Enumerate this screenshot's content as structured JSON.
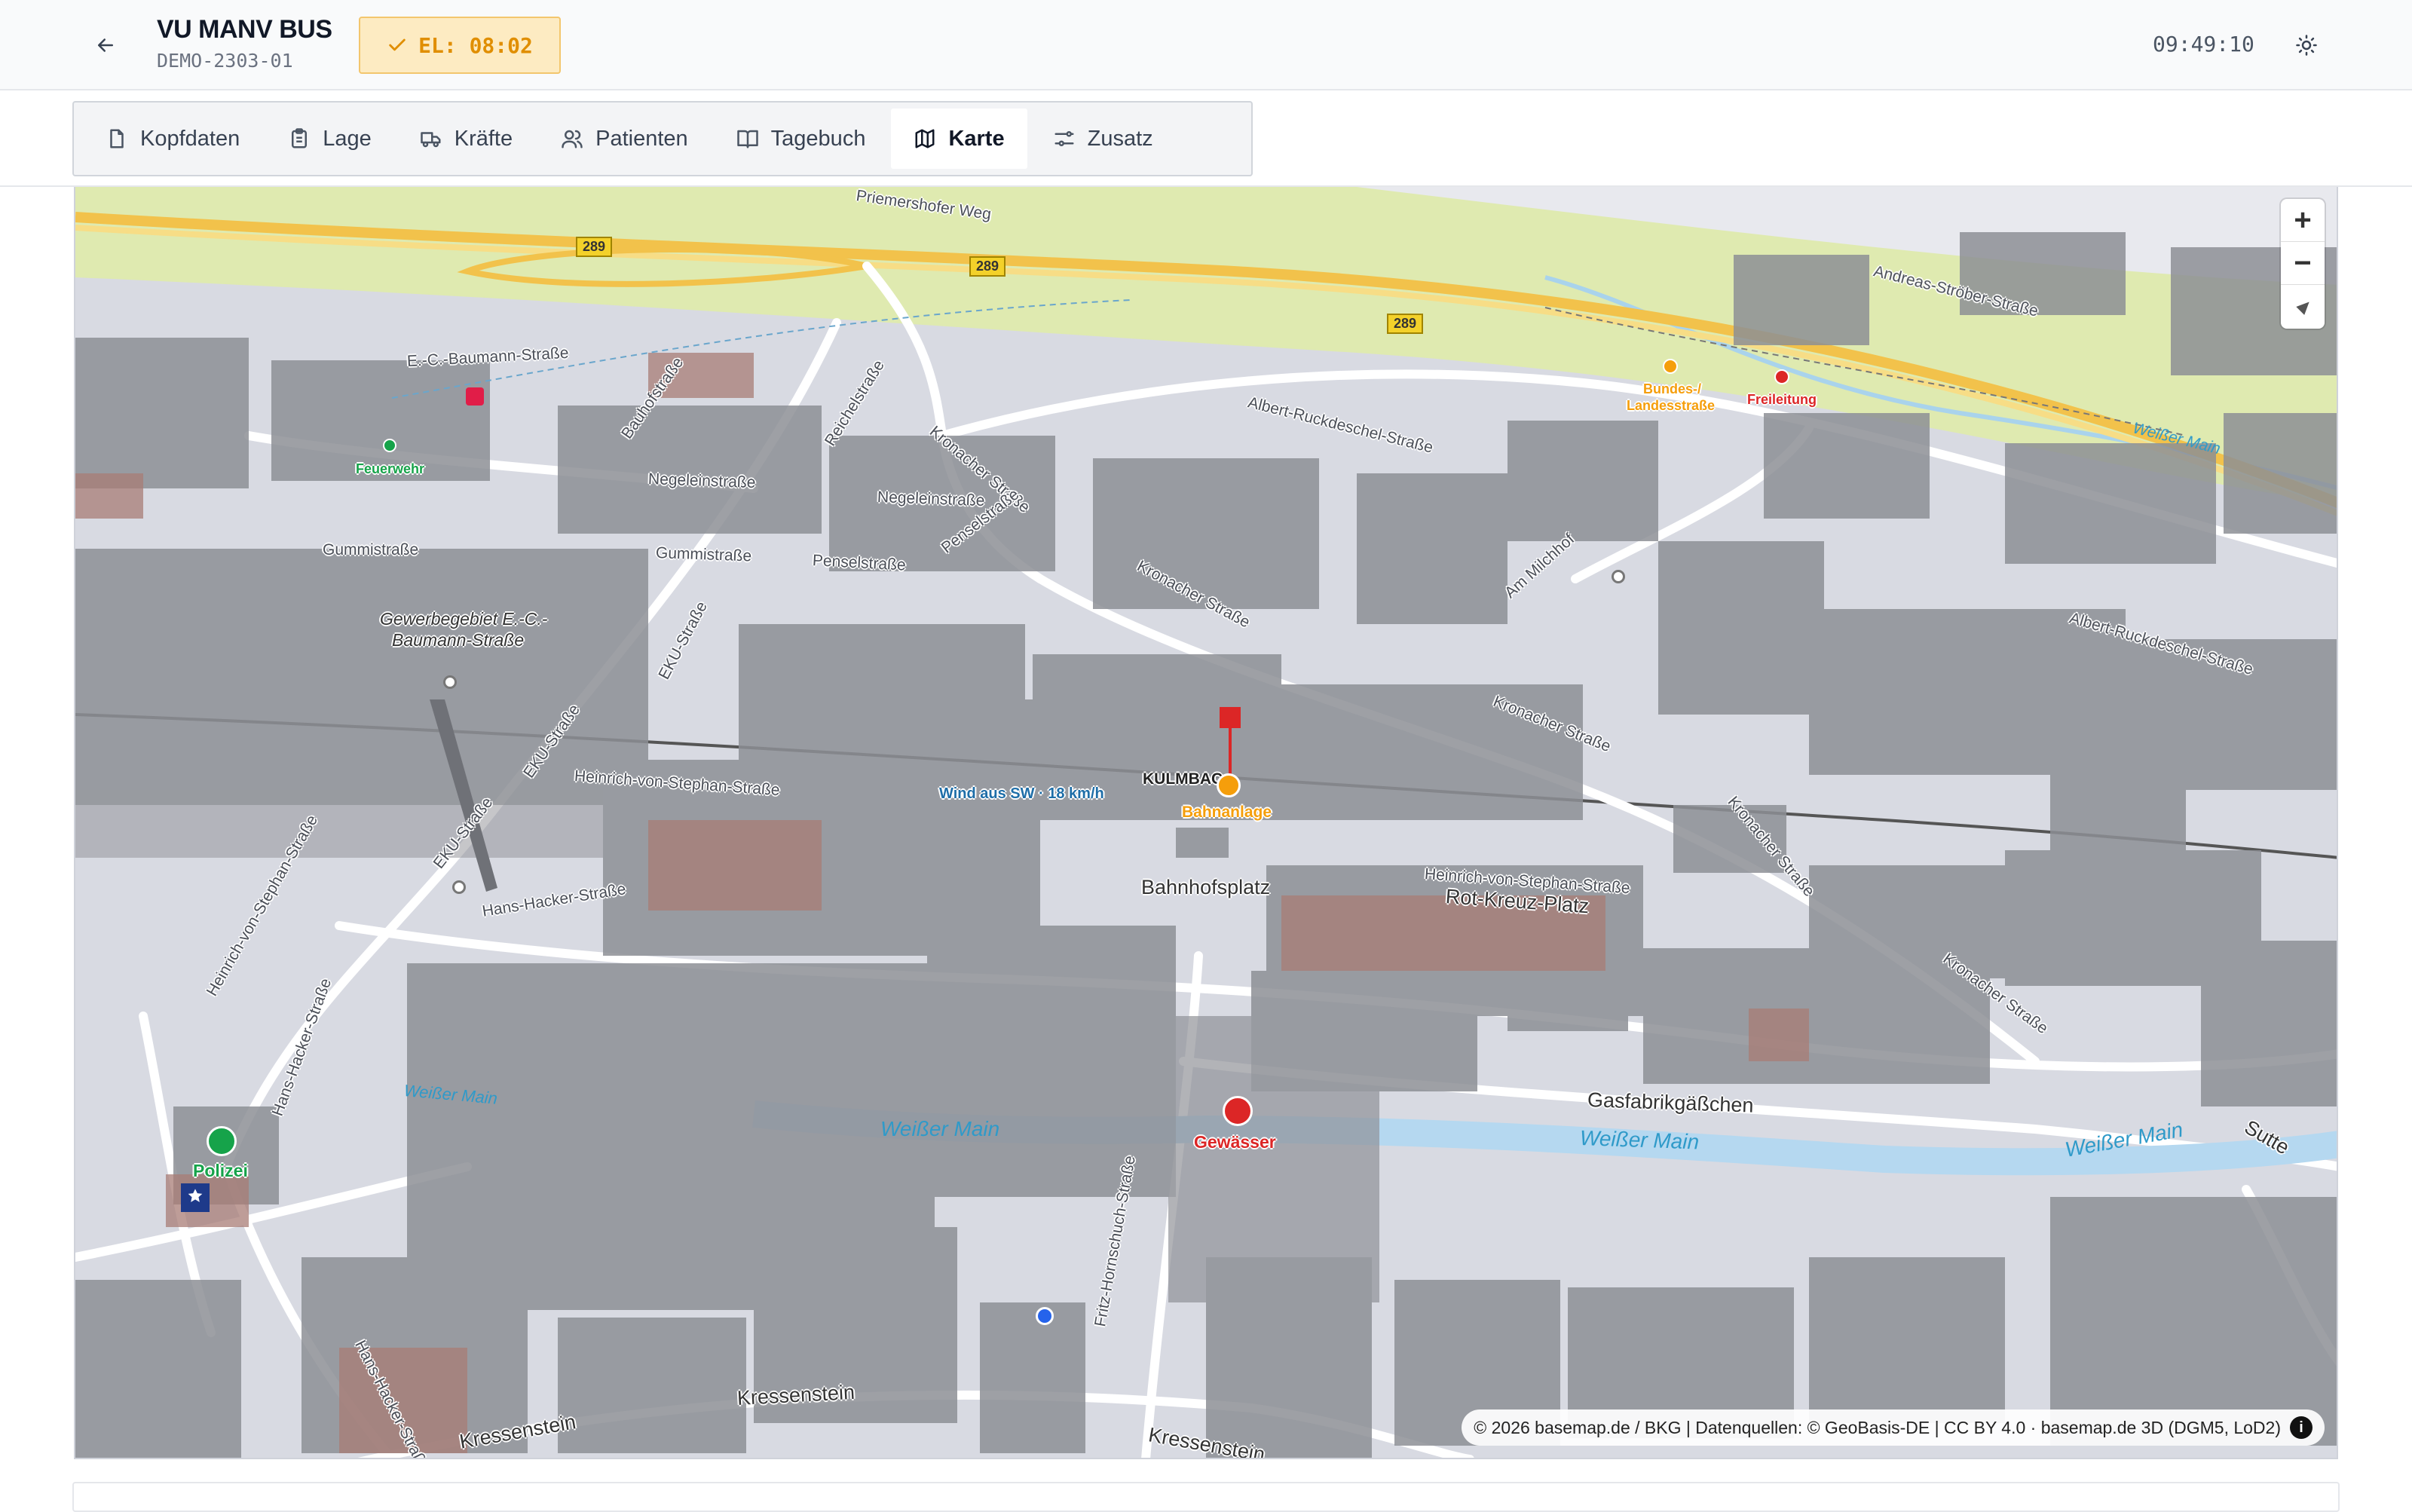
{
  "header": {
    "back_icon": "arrow-left-icon",
    "title": "VU MANV BUS",
    "subtitle": "DEMO-2303-01",
    "el_badge": "EL: 08:02",
    "clock": "09:49:10",
    "theme_icon": "sun-icon"
  },
  "tabs": [
    {
      "label": "Kopfdaten",
      "icon": "file-icon"
    },
    {
      "label": "Lage",
      "icon": "clipboard-icon"
    },
    {
      "label": "Kräfte",
      "icon": "truck-icon"
    },
    {
      "label": "Patienten",
      "icon": "users-icon"
    },
    {
      "label": "Tagebuch",
      "icon": "book-open-icon"
    },
    {
      "label": "Karte",
      "icon": "map-icon",
      "active": true
    },
    {
      "label": "Zusatz",
      "icon": "sliders-icon"
    }
  ],
  "map": {
    "streets": {
      "priemershofer_weg": "Priemershofer Weg",
      "ec_baumann_strasse": "E.-C.-Baumann-Straße",
      "bauhofstrasse": "Bauhofstraße",
      "reichelstrasse": "Reichelstraße",
      "negeleinstrasse_1": "Negeleinstraße",
      "negeleinstrasse_2": "Negeleinstraße",
      "kronacher_strasse_1": "Kronacher Straße",
      "kronacher_strasse_2": "Kronacher Straße",
      "kronacher_strasse_3": "Kronacher Straße",
      "kronacher_strasse_4": "Kronacher Straße",
      "kronacher_strasse_5": "Kronacher Straße",
      "albert_ruckdeschel_1": "Albert-Ruckdeschel-Straße",
      "albert_ruckdeschel_2": "Albert-Ruckdeschel-Straße",
      "andreas_stroeber": "Andreas-Ströber-Straße",
      "gummistrasse_1": "Gummistraße",
      "gummistrasse_2": "Gummistraße",
      "penselstrasse_1": "Penselstraße",
      "penselstrasse_2": "Penselstraße",
      "eku_strasse_1": "EKU-Straße",
      "eku_strasse_2": "EKU-Straße",
      "eku_strasse_3": "EKU-Straße",
      "am_milchhof": "Am Milchhof",
      "heinrich_von_stephan_1": "Heinrich-von-Stephan-Straße",
      "heinrich_von_stephan_2": "Heinrich-von-Stephan-Straße",
      "heinrich_von_stephan_3": "Heinrich-von-Stephan-Straße",
      "hans_hacker_1": "Hans-Hacker-Straße",
      "hans_hacker_2": "Hans-Hacker-Straße",
      "hans_hacker_3": "Hans-Hacker-Straße",
      "rot_kreuz_platz": "Rot-Kreuz-Platz",
      "bahnhofsplatz": "Bahnhofsplatz",
      "gasfabrikgaesschen": "Gasfabrikgäßchen",
      "fritz_hornschuch": "Fritz-Hornschuch-Straße",
      "kressenstein_1": "Kressenstein",
      "kressenstein_2": "Kressenstein",
      "kressenstein_3": "Kressenstein",
      "sutte": "Sutte"
    },
    "area_labels": {
      "gewerbegebiet_1": "Gewerbegebiet E.-C.-",
      "gewerbegebiet_2": "Baumann-Straße",
      "kulmbach": "KULMBAC"
    },
    "water_labels": {
      "weisser_main_1": "Weißer Main",
      "weisser_main_2": "Weißer Main",
      "weisser_main_3": "Weißer Main",
      "weisser_main_4": "Weißer Main",
      "weisser_main_5": "Weißer Main"
    },
    "road_shields": [
      "289",
      "289",
      "289"
    ],
    "pois": {
      "feuerwehr": "Feuerwehr",
      "bundes_1": "Bundes-/",
      "bundes_2": "Landesstraße",
      "freileitung": "Freileitung",
      "bahnanlage": "Bahnanlage",
      "wind": "Wind aus SW · 18 km/h",
      "polizei": "Polizei",
      "gewaesser": "Gewässer"
    },
    "colors": {
      "feuerwehr": "#16a34a",
      "bundes": "#f59e0b",
      "freileitung": "#dc2626",
      "bahnanlage": "#f59e0b",
      "polizei": "#16a34a",
      "gewaesser": "#dc2626",
      "incident_pin": "#dc2626"
    },
    "controls": {
      "zoom_in": "+",
      "zoom_out": "−",
      "compass_icon": "compass-icon"
    },
    "attribution": "© 2026 basemap.de / BKG | Datenquellen: © GeoBasis-DE | CC BY 4.0 · basemap.de 3D (DGM5, LoD2)",
    "info_icon": "info-icon",
    "info_glyph": "i"
  }
}
